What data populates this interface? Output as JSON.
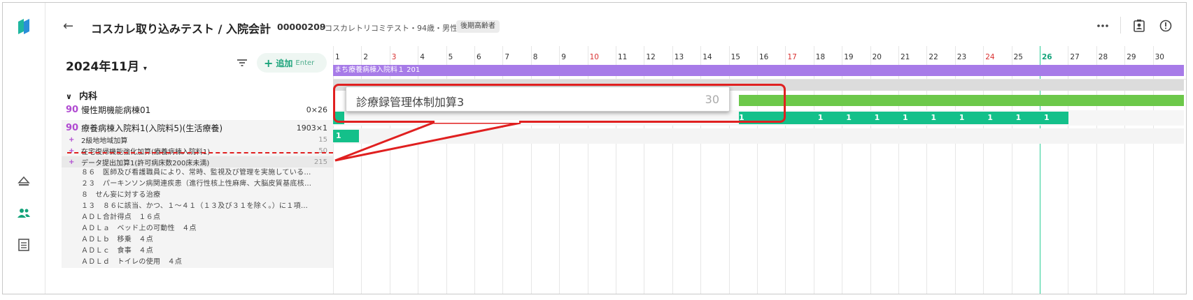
{
  "header": {
    "title": "コスカレ取り込みテスト / 入院会計",
    "patient_id": "00000209",
    "patient_info": "・コスカレトリコミテスト・94歳・男性",
    "badge": "後期高齢者"
  },
  "left": {
    "month": "2024年11月",
    "add_label": "追加",
    "add_hint": "Enter",
    "department": "内科",
    "items": [
      {
        "points": "90",
        "name": "慢性期機能病棟01",
        "count": "0×26"
      },
      {
        "points": "90",
        "name": "療養病棟入院料1(入院料5)(生活療養)",
        "count": "1903×1"
      }
    ],
    "sub_items": [
      {
        "name": "2級地地域加算",
        "count": "15"
      },
      {
        "name": "在宅復帰機能強化加算(療養病棟入院料1)",
        "count": "50"
      },
      {
        "name": "データ提出加算1(許可病床数200床未満)",
        "count": "215"
      }
    ],
    "details": [
      "８６　医師及び看護職員により、常時、監視及び管理を実施している…",
      "２３　パーキンソン病関連疾患（進行性核上性麻痺、大脳皮質基底核…",
      "８　せん妄に対する治療",
      "１３　８６に該当、かつ、１～４１（１３及び３１を除く。）に１項…",
      "ＡＤＬ合計得点　１６点",
      "ＡＤＬａ　ベッド上の可動性　４点",
      "ＡＤＬｂ　移乗　４点",
      "ＡＤＬｃ　食事　４点",
      "ＡＤＬｄ　トイレの使用　４点"
    ]
  },
  "calendar": {
    "days": [
      "1",
      "2",
      "3",
      "4",
      "5",
      "6",
      "7",
      "8",
      "9",
      "10",
      "11",
      "12",
      "13",
      "14",
      "15",
      "16",
      "17",
      "18",
      "19",
      "20",
      "21",
      "22",
      "23",
      "24",
      "25",
      "26",
      "27",
      "28",
      "29",
      "30"
    ],
    "red_days": [
      3,
      10,
      17,
      24
    ],
    "today": 26,
    "ward_bar_label": "まち療養病棟入院料１ 201",
    "green_cell_value": "1",
    "colors": {
      "ward": "#a77be8",
      "teal": "#14c08a",
      "light_green": "#6cc84a",
      "gray_bar": "#dcdcdc",
      "callout": "#e02020"
    }
  },
  "zoom": {
    "label": "診療録管理体制加算3",
    "value": "30"
  }
}
